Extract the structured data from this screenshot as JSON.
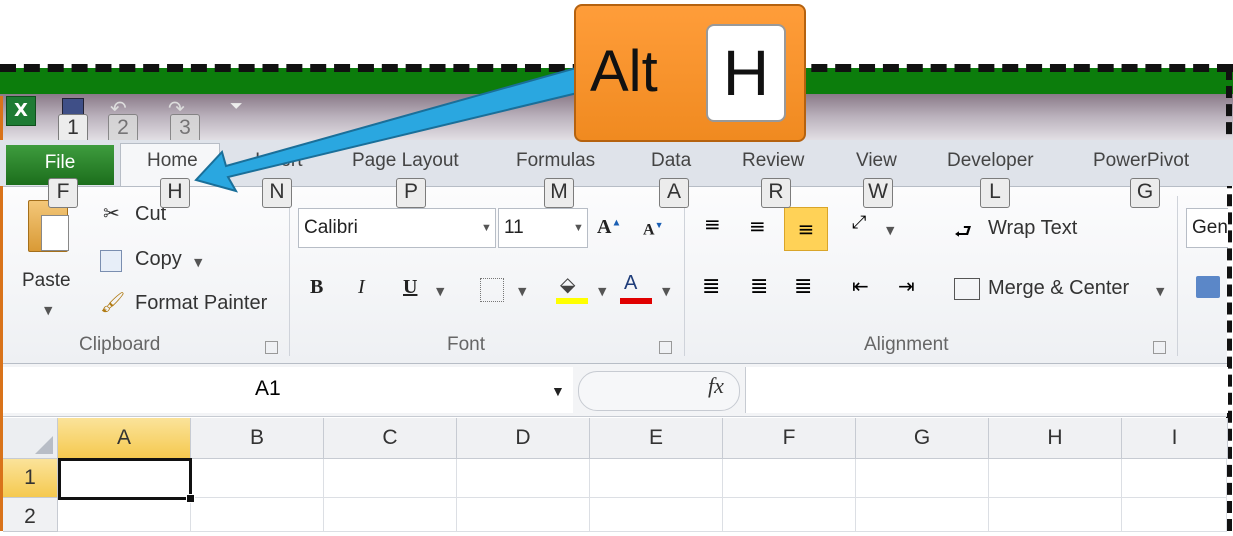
{
  "quick_access_keytips": [
    "1",
    "2",
    "3"
  ],
  "tabs": [
    {
      "label": "File",
      "keytip": "F"
    },
    {
      "label": "Home",
      "keytip": "H"
    },
    {
      "label": "Insert",
      "keytip": "N"
    },
    {
      "label": "Page Layout",
      "keytip": "P"
    },
    {
      "label": "Formulas",
      "keytip": "M"
    },
    {
      "label": "Data",
      "keytip": "A"
    },
    {
      "label": "Review",
      "keytip": "R"
    },
    {
      "label": "View",
      "keytip": "W"
    },
    {
      "label": "Developer",
      "keytip": "L"
    },
    {
      "label": "PowerPivot",
      "keytip": "G"
    }
  ],
  "clipboard": {
    "paste": "Paste",
    "cut": "Cut",
    "copy": "Copy",
    "format_painter": "Format Painter",
    "group": "Clipboard"
  },
  "font": {
    "name": "Calibri",
    "size": "11",
    "bold": "B",
    "italic": "I",
    "underline": "U",
    "font_color_glyph": "A",
    "group": "Font",
    "highlight_color": "#ffff00",
    "font_color": "#e00000"
  },
  "alignment": {
    "wrap_text": "Wrap Text",
    "merge_center": "Merge & Center",
    "group": "Alignment"
  },
  "number": {
    "format_partial": "Gen"
  },
  "formula_bar": {
    "name_box": "A1",
    "fx": "fx",
    "value": ""
  },
  "columns": [
    "A",
    "B",
    "C",
    "D",
    "E",
    "F",
    "G",
    "H",
    "I"
  ],
  "rows": [
    "1",
    "2"
  ],
  "selected_cell": "A1",
  "callout": {
    "modifier": "Alt",
    "key": "H"
  },
  "colors": {
    "accent_green": "#1d6e1d",
    "callout_orange": "#f59020",
    "arrow_blue": "#2aa7e0"
  }
}
